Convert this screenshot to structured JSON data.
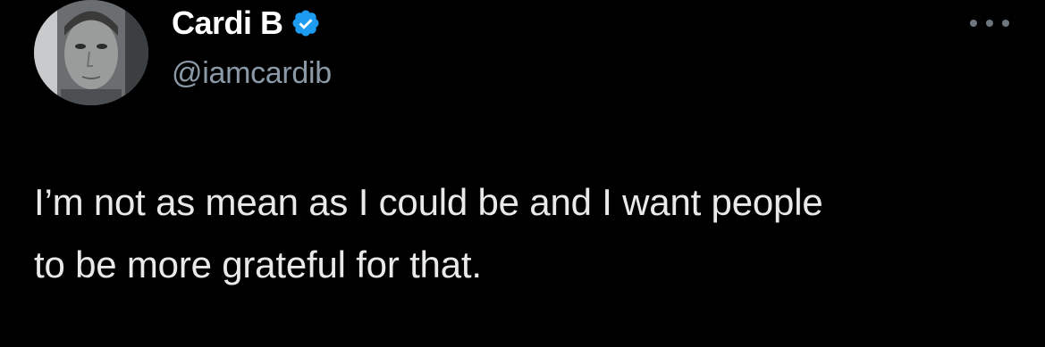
{
  "tweet": {
    "author": {
      "display_name": "Cardi B",
      "handle": "@iamcardib",
      "verified": true,
      "avatar_icon": "avatar-photo"
    },
    "more_icon": "more-horizontal-icon",
    "text_lines": [
      "I’m not as mean as I could be and I want people",
      "to be more grateful for that."
    ]
  },
  "colors": {
    "background": "#000000",
    "name": "#ffffff",
    "handle": "#8b98a5",
    "body_text": "#e7e9ea",
    "verified_badge": "#1d9bf0"
  }
}
